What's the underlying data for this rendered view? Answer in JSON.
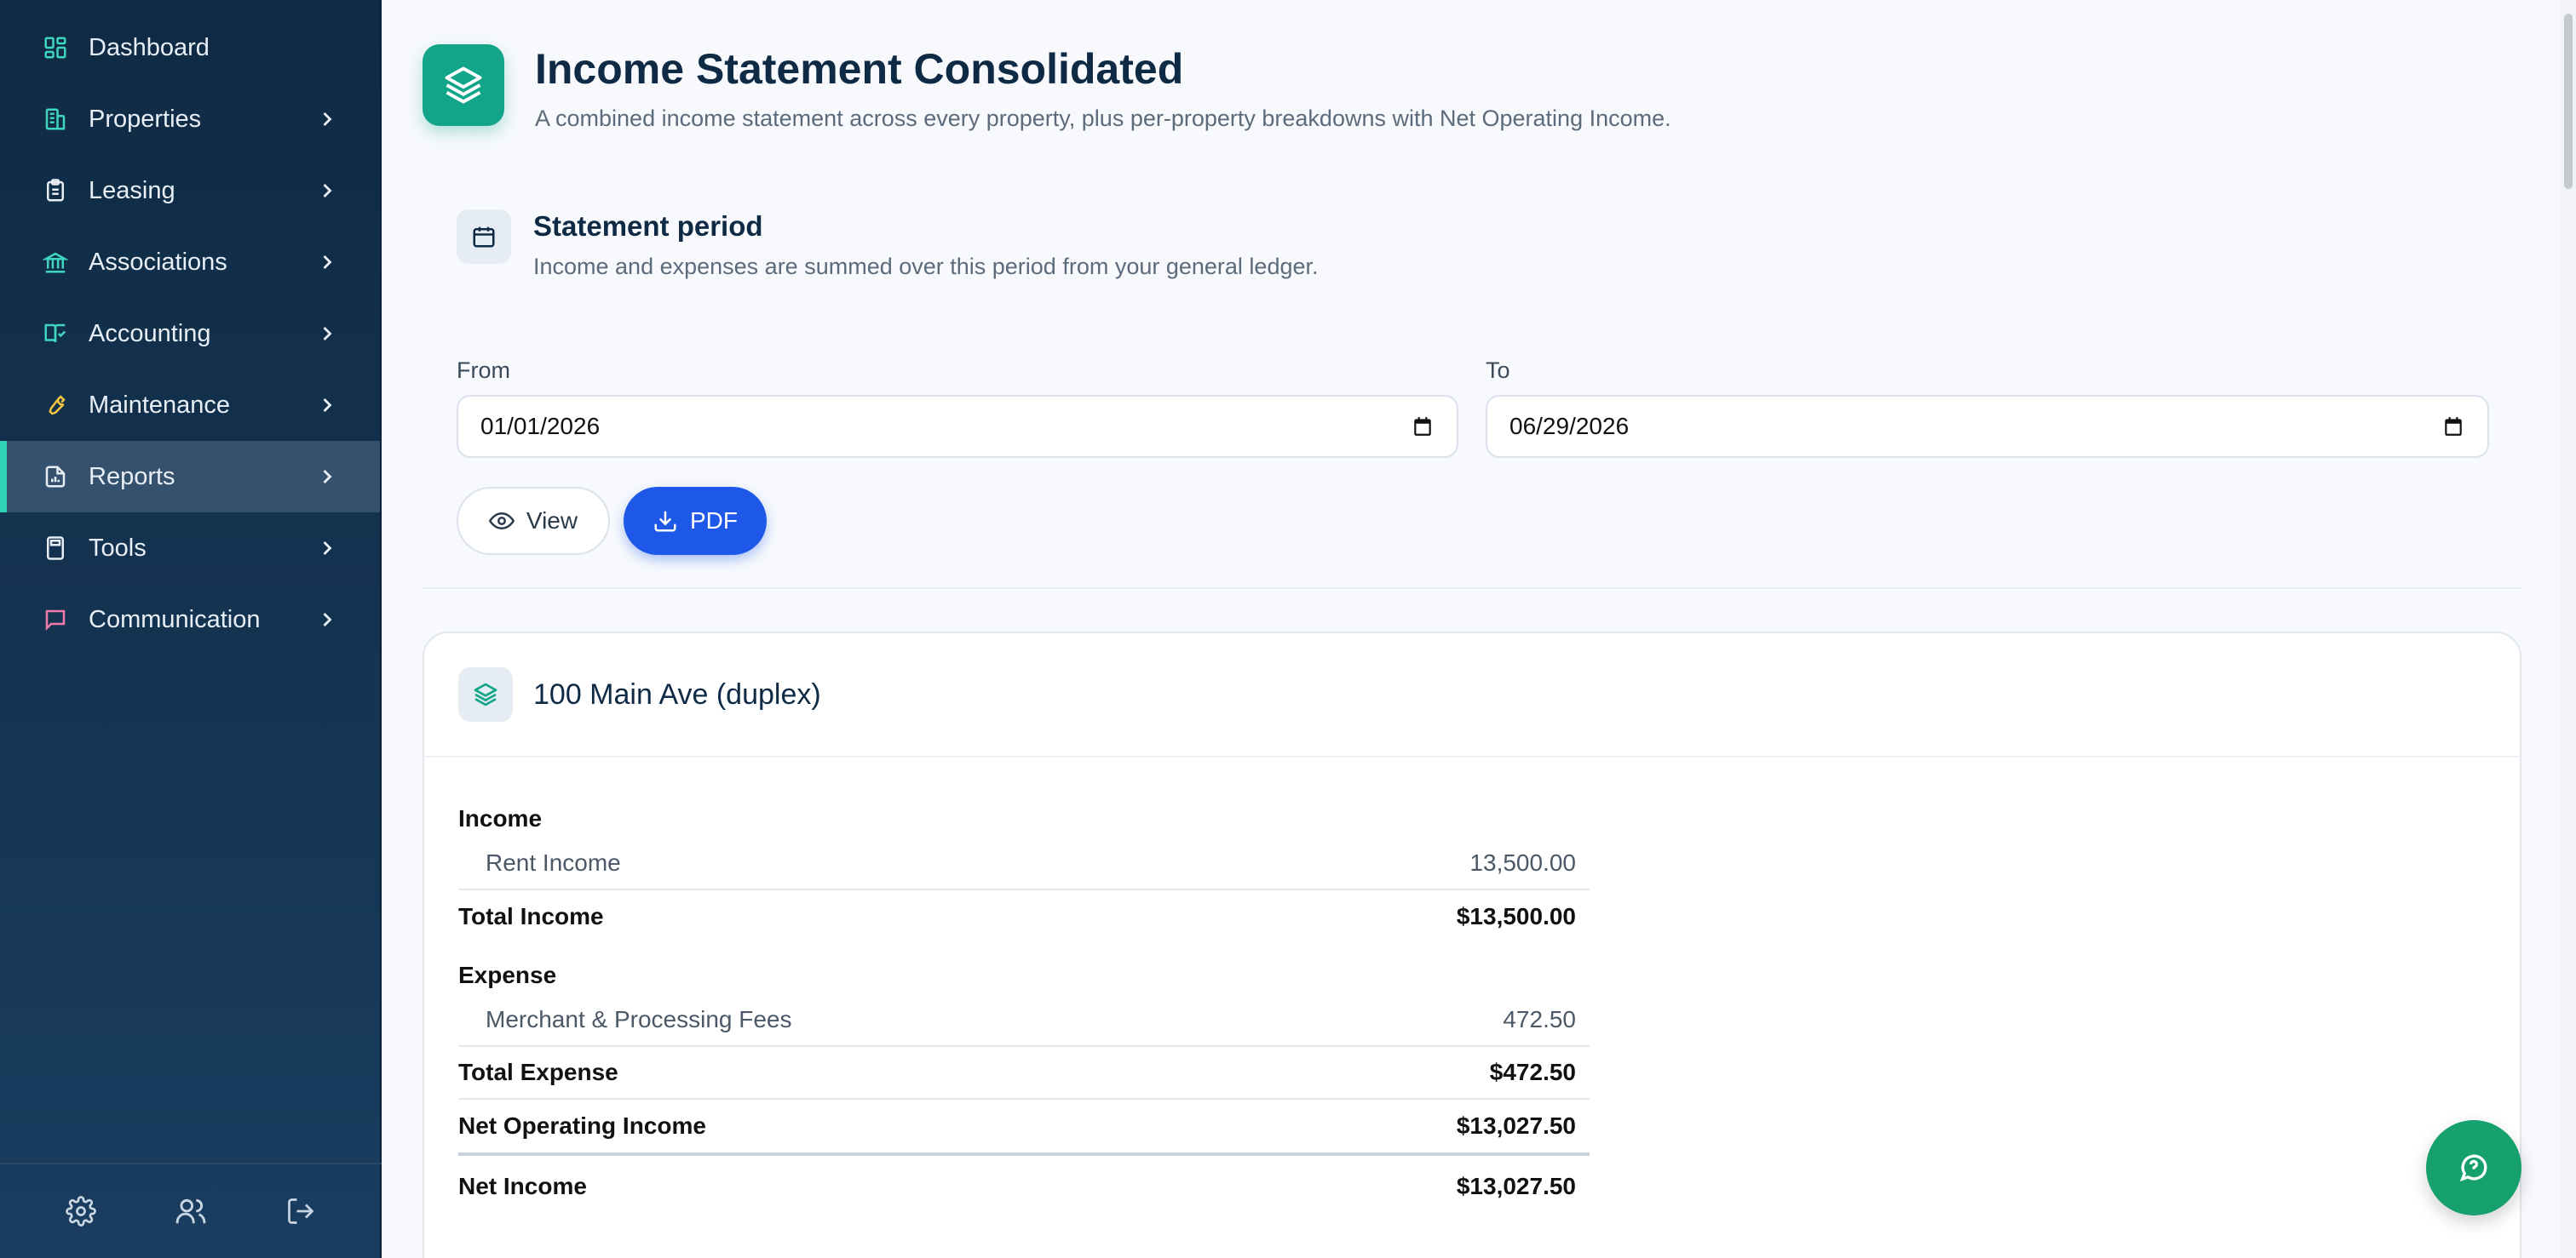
{
  "sidebar": {
    "items": [
      {
        "label": "Dashboard",
        "icon": "dashboard-icon",
        "has_chevron": false
      },
      {
        "label": "Properties",
        "icon": "building-icon",
        "has_chevron": true
      },
      {
        "label": "Leasing",
        "icon": "clipboard-icon",
        "has_chevron": true
      },
      {
        "label": "Associations",
        "icon": "bank-icon",
        "has_chevron": true
      },
      {
        "label": "Accounting",
        "icon": "book-icon",
        "has_chevron": true
      },
      {
        "label": "Maintenance",
        "icon": "wrench-icon",
        "has_chevron": true
      },
      {
        "label": "Reports",
        "icon": "report-icon",
        "has_chevron": true,
        "active": true
      },
      {
        "label": "Tools",
        "icon": "calculator-icon",
        "has_chevron": true
      },
      {
        "label": "Communication",
        "icon": "chat-icon",
        "has_chevron": true
      }
    ],
    "footer": [
      "settings-icon",
      "users-icon",
      "logout-icon"
    ]
  },
  "header": {
    "title": "Income Statement Consolidated",
    "subtitle": "A combined income statement across every property, plus per-property breakdowns with Net Operating Income."
  },
  "period": {
    "title": "Statement period",
    "description": "Income and expenses are summed over this period from your general ledger.",
    "from_label": "From",
    "from_value": "01/01/2026",
    "to_label": "To",
    "to_value": "06/29/2026"
  },
  "actions": {
    "view_label": "View",
    "pdf_label": "PDF"
  },
  "property_card": {
    "title": "100 Main Ave (duplex)",
    "income_title": "Income",
    "income_lines": [
      {
        "name": "Rent Income",
        "amount": "13,500.00"
      }
    ],
    "total_income_label": "Total Income",
    "total_income": "$13,500.00",
    "expense_title": "Expense",
    "expense_lines": [
      {
        "name": "Merchant & Processing Fees",
        "amount": "472.50"
      }
    ],
    "total_expense_label": "Total Expense",
    "total_expense": "$472.50",
    "noi_label": "Net Operating Income",
    "noi": "$13,027.50",
    "net_income_label": "Net Income",
    "net_income": "$13,027.50"
  },
  "colors": {
    "sidebar_bg": "#0f2a44",
    "accent_teal": "#13a58a",
    "primary_blue": "#1e58e8",
    "help_green": "#15a06e"
  }
}
